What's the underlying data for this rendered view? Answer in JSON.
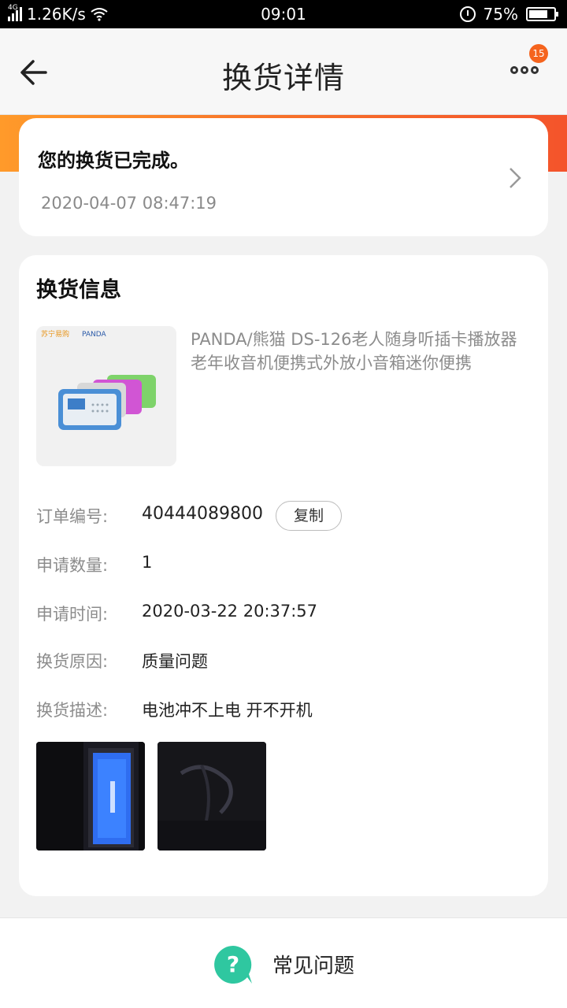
{
  "status_bar": {
    "network_type": "4G",
    "speed": "1.26K/s",
    "time": "09:01",
    "battery": "75%",
    "battery_level": 0.75
  },
  "header": {
    "title": "换货详情",
    "badge_count": "15"
  },
  "status_card": {
    "message": "您的换货已完成。",
    "timestamp": "2020-04-07 08:47:19"
  },
  "info": {
    "section_title": "换货信息",
    "product_name": "PANDA/熊猫 DS-126老人随身听插卡播放器老年收音机便携式外放小音箱迷你便携",
    "product_img_text": {
      "store": "苏宁易购",
      "brand": "PANDA"
    },
    "fields": [
      {
        "label": "订单编号:",
        "value": "40444089800"
      },
      {
        "label": "申请数量:",
        "value": "1"
      },
      {
        "label": "申请时间:",
        "value": "2020-03-22 20:37:57"
      },
      {
        "label": "换货原因:",
        "value": "质量问题"
      },
      {
        "label": "换货描述:",
        "value": "电池冲不上电 开不开机"
      }
    ],
    "copy_label": "复制"
  },
  "bottom": {
    "faq_label": "常见问题"
  },
  "colors": {
    "accent_orange": "#f7712a",
    "faq_green": "#2fc7a0"
  }
}
